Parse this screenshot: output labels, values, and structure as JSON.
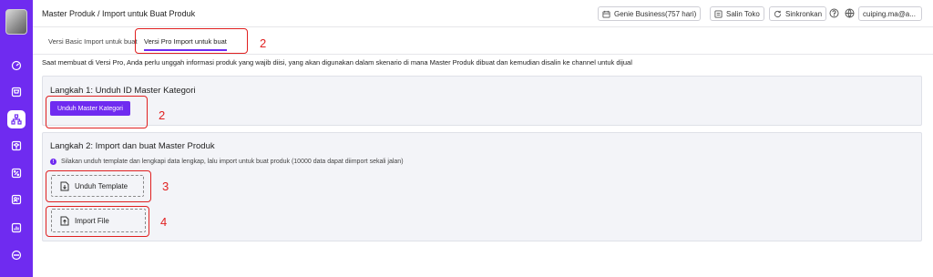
{
  "header": {
    "breadcrumb": "Master Produk / Import untuk Buat Produk",
    "plan_label": "Genie Business(757 hari)",
    "copy_store_label": "Salin Toko",
    "sync_label": "Sinkronkan",
    "account_label": "cuiping.ma@a..."
  },
  "tabs": [
    {
      "label": "Versi Basic Import untuk buat"
    },
    {
      "label": "Versi Pro Import untuk buat"
    }
  ],
  "description": "Saat membuat di Versi Pro, Anda perlu unggah informasi produk yang wajib diisi, yang akan digunakan dalam skenario di mana Master Produk dibuat dan kemudian disalin ke channel untuk dijual",
  "step1": {
    "title": "Langkah 1: Unduh ID Master Kategori",
    "button_label": "Unduh Master Kategori"
  },
  "step2": {
    "title": "Langkah 2: Import dan buat Master Produk",
    "info": "Silakan unduh template dan lengkapi data lengkap, lalu import untuk buat produk (10000 data dapat diimport sekali jalan)",
    "download_template_label": "Unduh Template",
    "import_file_label": "Import File"
  },
  "annotations": {
    "tab_marker": "2",
    "button_marker": "2",
    "template_marker": "3",
    "import_marker": "4"
  },
  "colors": {
    "accent": "#6f2bf0",
    "annotation": "#e02020",
    "panel_bg": "#f3f4f8"
  },
  "icons": [
    "avatar",
    "dashboard-icon",
    "cart-icon",
    "product-tree-icon",
    "box-icon",
    "percent-icon",
    "users-icon",
    "chart-icon",
    "chat-icon",
    "calendar-icon",
    "copy-store-icon",
    "sync-icon",
    "help-icon",
    "globe-icon",
    "chevron-down-icon",
    "download-file-icon",
    "upload-file-icon"
  ]
}
